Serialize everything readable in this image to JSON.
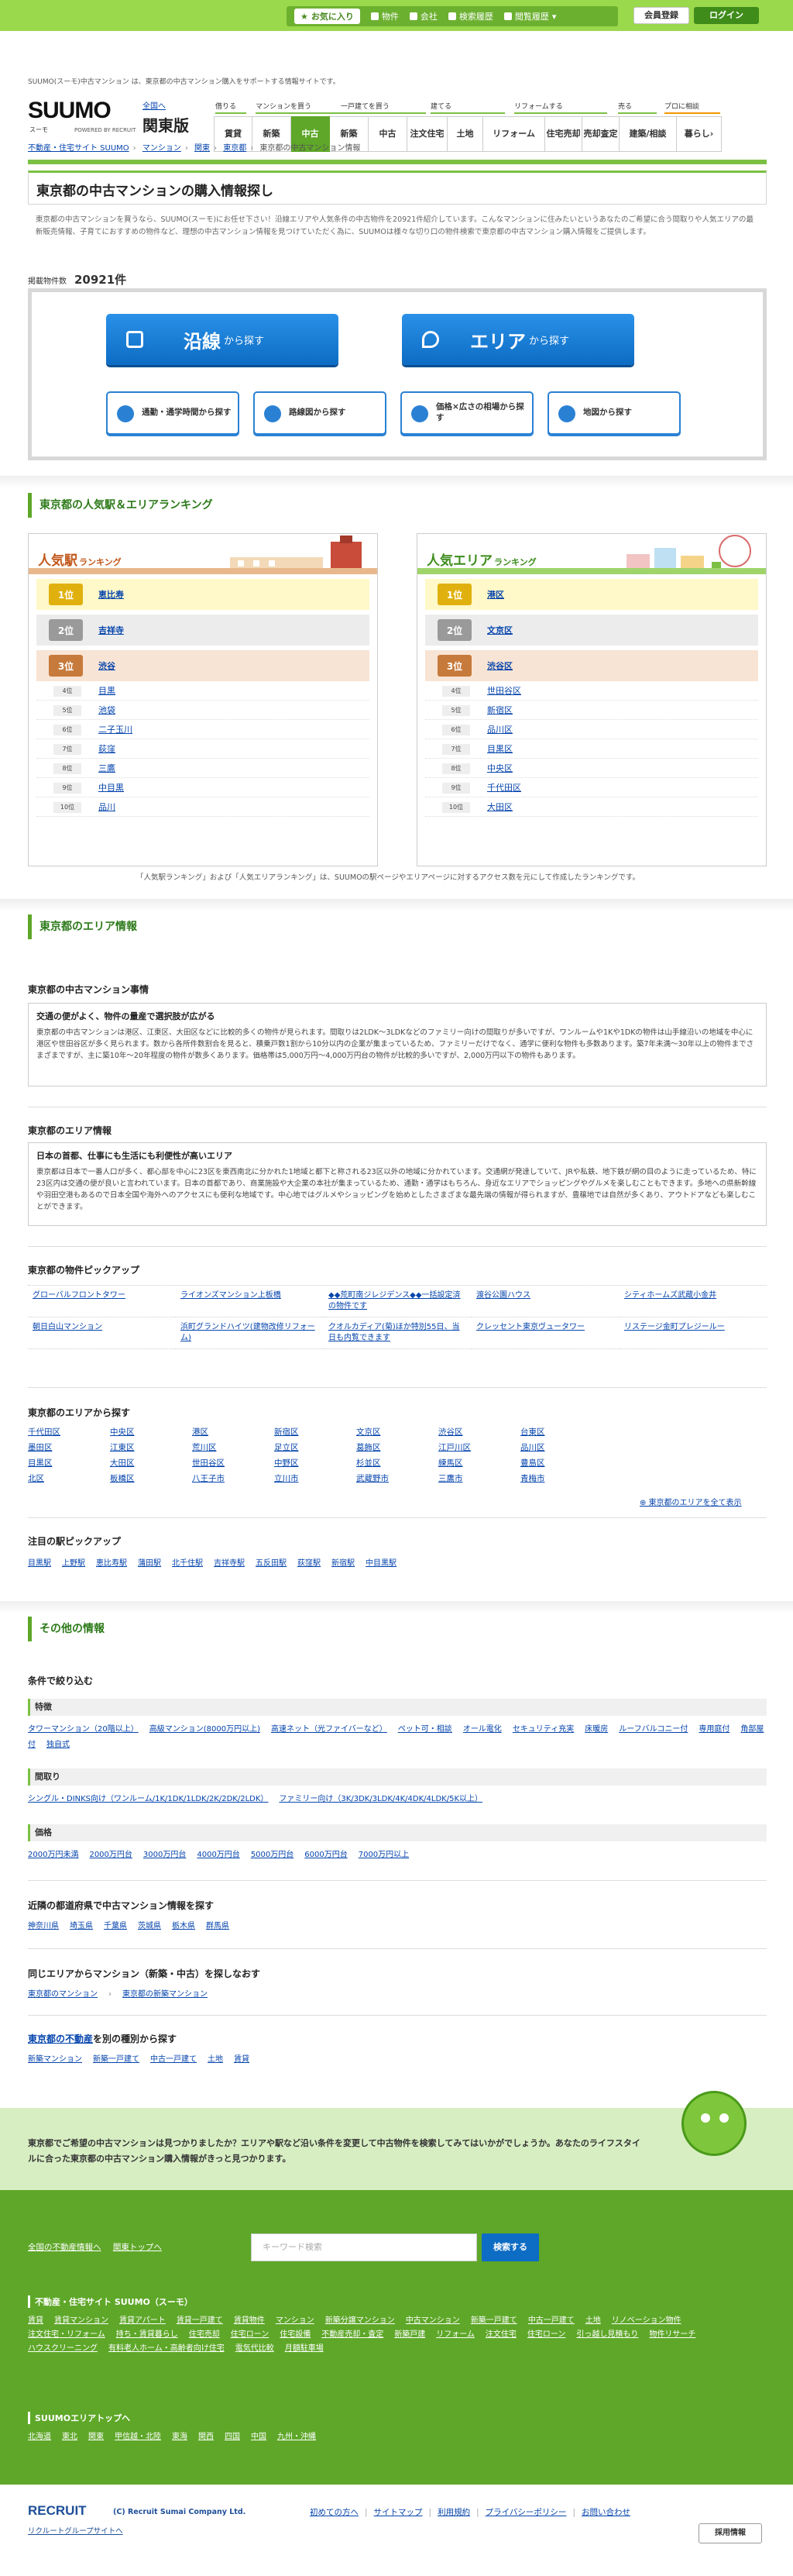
{
  "topbar": {
    "favorites": "お気に入り",
    "property": "物件",
    "company": "会社",
    "search_history": "検索履歴",
    "history": "閲覧履歴",
    "register": "会員登録",
    "login": "ログイン"
  },
  "header": {
    "tagline": "SUUMO(スーモ)中古マンション は、東京都の中古マンション購入をサポートする情報サイトです。",
    "logo": "SUUMO",
    "logo_sub": "スーモ",
    "logo_rec": "POWERED BY RECRUIT",
    "region_link": "全国へ",
    "region": "関東版",
    "groups": [
      {
        "label": "借りる"
      },
      {
        "label": "マンションを買う"
      },
      {
        "label": "一戸建てを買う"
      },
      {
        "label": "建てる"
      },
      {
        "label": "リフォームする"
      },
      {
        "label": "売る"
      },
      {
        "label": "プロに相談"
      }
    ],
    "tabs": [
      {
        "label": "賃貸"
      },
      {
        "label": "新築"
      },
      {
        "label": "中古"
      },
      {
        "label": "新築"
      },
      {
        "label": "中古"
      },
      {
        "label": "注文住宅"
      },
      {
        "label": "土地"
      },
      {
        "label": "リフォーム"
      },
      {
        "label": "住宅売却"
      },
      {
        "label": "売却査定"
      },
      {
        "label": "建築/相談"
      },
      {
        "label": "暮らし"
      }
    ]
  },
  "breadcrumb": [
    "不動産・住宅サイト SUUMO",
    "マンション",
    "関東",
    "東京都",
    "東京都の中古マンション情報"
  ],
  "title": "東京都の中古マンションの購入情報探し",
  "lead": "東京都の中古マンションを買うなら、SUUMO(スーモ)にお任せ下さい！沿線エリアや人気条件の中古物件を20921件紹介しています。こんなマンションに住みたいというあなたのご希望に合う間取りや人気エリアの最新販売情報、子育てにおすすめの物件など、理想の中古マンション情報を見つけていただく為に、SUUMOは様々な切り口の物件検索で東京都の中古マンション購入情報をご提供します。",
  "count": {
    "label": "掲載物件数",
    "value": "20921件"
  },
  "search": {
    "line_big": "沿線",
    "line_sm": "から探す",
    "area_big": "エリア",
    "area_sm": "から探す",
    "commute": "通勤・通学時間から探す",
    "route": "路線図から探す",
    "price": "価格×広さの相場から探す",
    "map": "地図から探す"
  },
  "ranking": {
    "heading": "東京都の人気駅＆エリアランキング",
    "station_title": "人気駅",
    "area_title": "人気エリア",
    "ranking_word": "ランキング",
    "rank_labels": [
      "1位",
      "2位",
      "3位",
      "4位",
      "5位",
      "6位",
      "7位",
      "8位",
      "9位",
      "10位"
    ],
    "stations": [
      "恵比寿",
      "吉祥寺",
      "渋谷",
      "目黒",
      "池袋",
      "二子玉川",
      "荻窪",
      "三鷹",
      "中目黒",
      "品川"
    ],
    "areas": [
      "港区",
      "文京区",
      "渋谷区",
      "世田谷区",
      "新宿区",
      "品川区",
      "目黒区",
      "中央区",
      "千代田区",
      "大田区"
    ],
    "note": "「人気駅ランキング」および「人気エリアランキング」は、SUUMOの駅ページやエリアページに対するアクセス数を元にして作成したランキングです。"
  },
  "areainfo": {
    "heading": "東京都のエリア情報",
    "market_title": "東京都の中古マンション事情",
    "market_h": "交通の便がよく、物件の量産で選択肢が広がる",
    "market_p": "東京都の中古マンションは港区、江東区、大田区などに比較的多くの物件が見られます。間取りは2LDK～3LDKなどのファミリー向けの間取りが多いですが、ワンルームや1Kや1DKの物件は山手線沿いの地域を中心に港区や世田谷区が多く見られます。数から各所件数割合を見ると、積乗戸数1割から10分以内の企業が集まっているため、ファミリーだけでなく、通学に便利な物件も多数あります。築7年未満～30年以上の物件までさまざまですが、主に築10年～20年程度の物件が数多くあります。価格帯は5,000万円～4,000万円台の物件が比較的多いですが、2,000万円以下の物件もあります。",
    "area_title": "東京都のエリア情報",
    "area_h": "日本の首都、仕事にも生活にも利便性が高いエリア",
    "area_p": "東京都は日本で一番人口が多く、都心部を中心に23区を東西南北に分かれた1地域と都下と称される23区以外の地域に分かれています。交通網が発達していて、JRや私鉄、地下鉄が網の目のように走っているため、特に23区内は交通の便が良いと言われています。日本の首都であり、商業施設や大企業の本社が集まっているため、通勤・通学はもちろん、身近なエリアでショッピングやグルメを楽しむこともできます。多地への県新幹線や羽田空港もあるので日本全国や海外へのアクセスにも便利な地域です。中心地ではグルメやショッピングを始めとしたさまざまな最先端の情報が得られますが、豊穣地では自然が多くあり、アウトドアなども楽しむことができます。",
    "pickup_title": "東京都の物件ピックアップ",
    "pickups": [
      "グローバルフロントタワー",
      "ライオンズマンション上板橋",
      "◆◆荒町南ジレジデンス◆◆一括設定済の物件です",
      "渡谷公園ハウス",
      "シティホームズ武蔵小金井",
      "朝日白山マンション",
      "浜町グランドハイツ(建物改修リフォーム)",
      "クオルカディア(菊)ほか特別55日、当日も内覧できます",
      "クレッセント東京ヴュータワー",
      "リステージ金町プレジールー"
    ],
    "wards_title": "東京都のエリアから探す",
    "wards": [
      "千代田区",
      "中央区",
      "港区",
      "新宿区",
      "文京区",
      "渋谷区",
      "台東区",
      "墨田区",
      "江東区",
      "荒川区",
      "足立区",
      "葛飾区",
      "江戸川区",
      "品川区",
      "目黒区",
      "大田区",
      "世田谷区",
      "中野区",
      "杉並区",
      "練馬区",
      "豊島区",
      "北区",
      "板橋区",
      "八王子市",
      "立川市",
      "武蔵野市",
      "三鷹市",
      "青梅市"
    ],
    "wards_all": "東京都のエリアを全て表示",
    "stations_title": "注目の駅ピックアップ",
    "pick_stations": [
      "目黒駅",
      "上野駅",
      "恵比寿駅",
      "蒲田駅",
      "北千住駅",
      "吉祥寺駅",
      "五反田駅",
      "荻窪駅",
      "新宿駅",
      "中目黒駅"
    ]
  },
  "other": {
    "heading": "その他の情報",
    "cond_title": "条件で絞り込む",
    "feat_h": "特徴",
    "features": [
      "タワーマンション（20階以上）",
      "高級マンション(8000万円以上)",
      "高速ネット（光ファイバーなど）",
      "ペット可・相談",
      "オール電化",
      "セキュリティ充実",
      "床暖房",
      "ルーフバルコニー付",
      "専用庭付",
      "角部屋付",
      "独自式"
    ],
    "plan_h": "間取り",
    "plans": [
      "シングル・DINKS向け（ワンルーム/1K/1DK/1LDK/2K/2DK/2LDK）",
      "ファミリー向け（3K/3DK/3LDK/4K/4DK/4LDK/5K以上）"
    ],
    "price_h": "価格",
    "prices": [
      "2000万円未満",
      "2000万円台",
      "3000万円台",
      "4000万円台",
      "5000万円台",
      "6000万円台",
      "7000万円以上"
    ],
    "near_title": "近隣の都道府県で中古マンション情報を探す",
    "near": [
      "神奈川県",
      "埼玉県",
      "千葉県",
      "茨城県",
      "栃木県",
      "群馬県"
    ],
    "same_title": "同じエリアからマンション（新築・中古）を探しなおす",
    "same": [
      "東京都のマンション",
      "東京都の新築マンション"
    ],
    "other_title_link": "東京都の不動産",
    "other_title_rest": "を別の種別から探す",
    "other_links": [
      "新築マンション",
      "新築一戸建て",
      "中古一戸建て",
      "土地",
      "賃貸"
    ]
  },
  "cta": {
    "text": "東京都でご希望の中古マンションは見つかりましたか？エリアや駅など沿い条件を変更して中古物件を検索してみてはいかがでしょうか。あなたのライフスタイルに合った東京都の中古マンション購入情報がきっと見つかります。"
  },
  "footer": {
    "links": [
      "全国の不動産情報へ",
      "関東トップへ"
    ],
    "keyword_placeholder": "キーワード検索",
    "search_btn": "検索する",
    "site_title": "不動産・住宅サイト SUUMO（スーモ）",
    "site_links": [
      "賃貸",
      "賃貸マンション",
      "賃貸アパート",
      "賃貸一戸建て",
      "賃貸物件",
      "マンション",
      "新築分譲マンション",
      "中古マンション",
      "新築一戸建て",
      "中古一戸建て",
      "土地",
      "リノベーション物件",
      "注文住宅・リフォーム",
      "持ち・賃貸暮らし",
      "住宅売却",
      "住宅ローン",
      "住宅設備",
      "不動産売却・査定",
      "新築戸建",
      "リフォーム",
      "注文住宅",
      "住宅ローン",
      "引っ越し見積もり",
      "物件リサーチ",
      "ハウスクリーニング",
      "有料老人ホーム・高齢者向け住宅",
      "電気代比較",
      "月額駐車場"
    ],
    "area_title": "SUUMOエリアトップへ",
    "area_links": [
      "北海道",
      "東北",
      "関東",
      "甲信越・北陸",
      "東海",
      "関西",
      "四国",
      "中国",
      "九州・沖縄"
    ]
  },
  "bottom": {
    "logo": "RECRUIT",
    "copyright": "(C) Recruit Sumai Company Ltd.",
    "group": "リクルートグループサイトへ",
    "links": [
      "初めての方へ",
      "サイトマップ",
      "利用規約",
      "プライバシーポリシー",
      "お問い合わせ"
    ],
    "recruit_btn": "採用情報"
  }
}
